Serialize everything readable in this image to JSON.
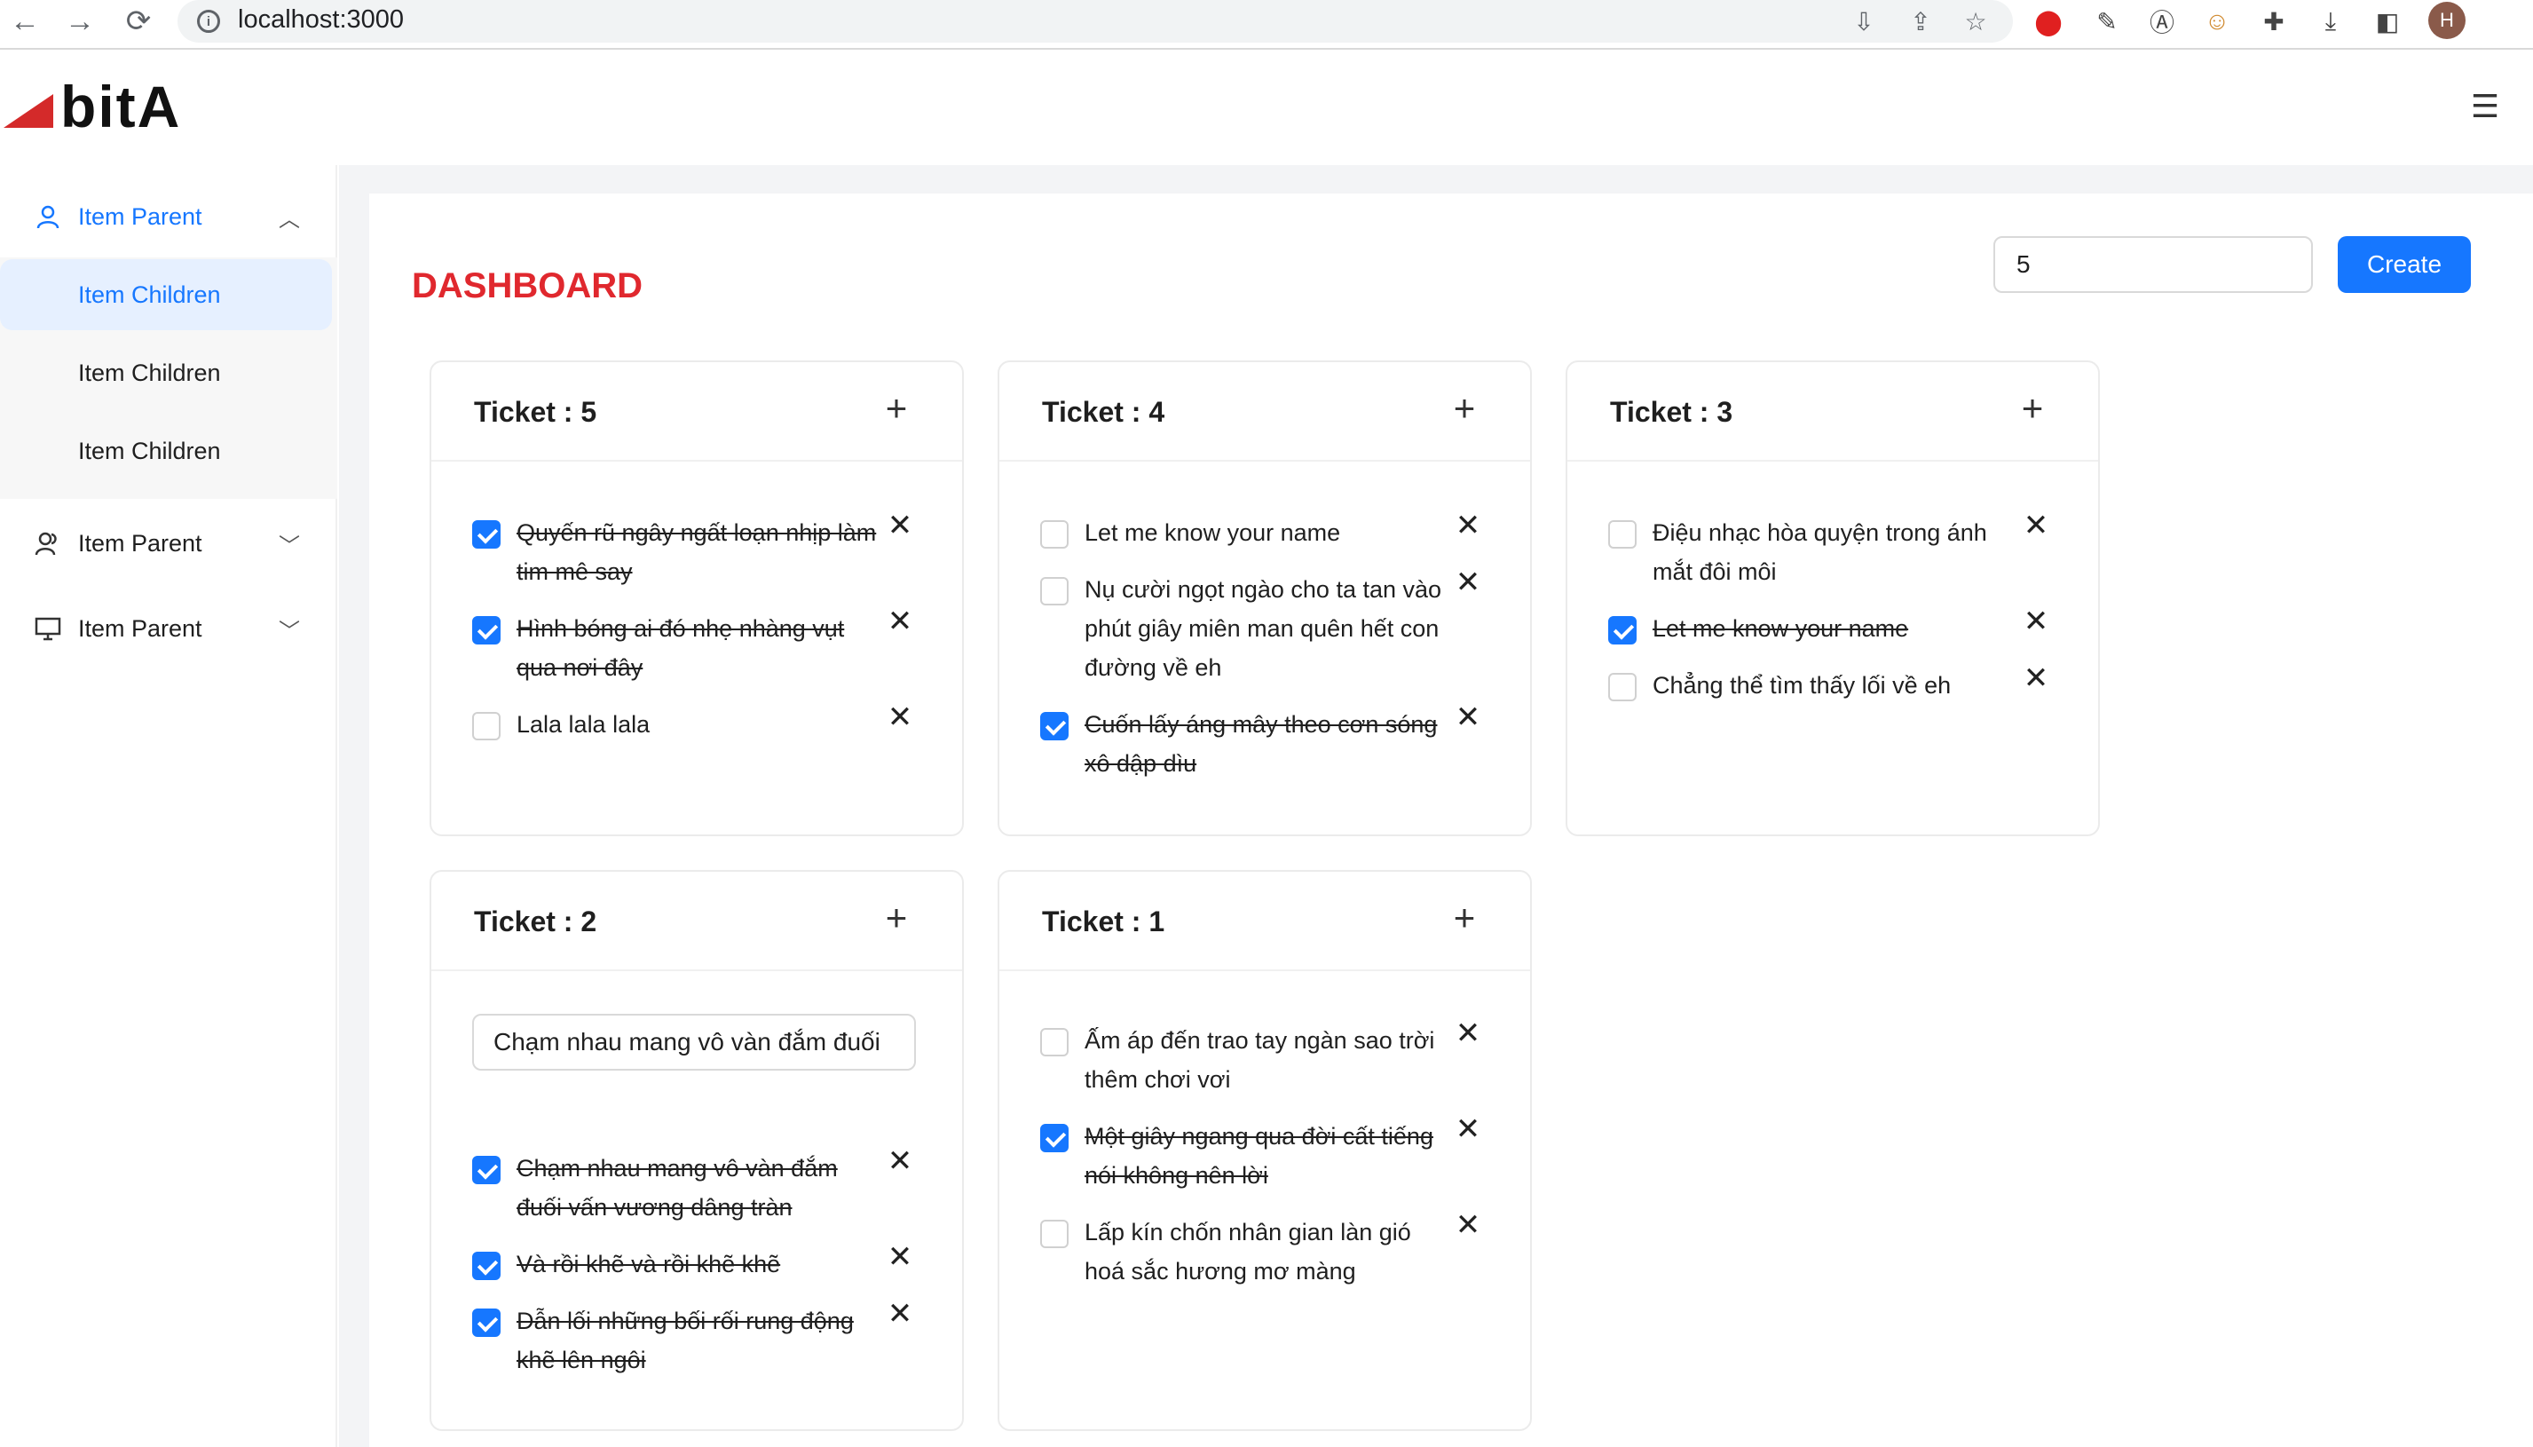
{
  "browser": {
    "url": "localhost:3000",
    "profile_initial": "H",
    "icons": [
      "back-icon",
      "forward-icon",
      "reload-icon",
      "site-info-icon",
      "install-icon",
      "share-icon",
      "bookmark-star-icon"
    ],
    "extensions": [
      "opera-extension-icon",
      "eyedropper-extension-icon",
      "font-extension-icon",
      "emoji-extension-icon",
      "puzzle-extensions-icon",
      "download-icon",
      "side-panel-icon"
    ]
  },
  "app": {
    "logo_text": "bitA",
    "brand_color": "#d42a2a"
  },
  "sidebar": {
    "parents": [
      {
        "label": "Item Parent",
        "icon": "user-icon",
        "expanded": true
      },
      {
        "label": "Item Parent",
        "icon": "users-icon",
        "expanded": false
      },
      {
        "label": "Item Parent",
        "icon": "desktop-icon",
        "expanded": false
      }
    ],
    "children": [
      {
        "label": "Item Children",
        "selected": true
      },
      {
        "label": "Item Children",
        "selected": false
      },
      {
        "label": "Item Children",
        "selected": false
      }
    ]
  },
  "dashboard": {
    "title": "DASHBOARD",
    "title_color": "#e0282e",
    "create_input_value": "5",
    "create_button": "Create",
    "accent_color": "#1677ff"
  },
  "tickets": [
    {
      "title": "Ticket : 5",
      "todos": [
        {
          "text": "Quyến rũ ngây ngất loạn nhịp làm tim mê say",
          "done": true
        },
        {
          "text": "Hình bóng ai đó nhẹ nhàng vụt qua nơi đây",
          "done": true
        },
        {
          "text": "Lala lala lala",
          "done": false
        }
      ]
    },
    {
      "title": "Ticket : 4",
      "todos": [
        {
          "text": "Let me know your name",
          "done": false
        },
        {
          "text": "Nụ cười ngọt ngào cho ta tan vào phút giây miên man quên hết con đường về eh",
          "done": false
        },
        {
          "text": "Cuốn lấy áng mây theo cơn sóng xô dập dìu",
          "done": true
        }
      ]
    },
    {
      "title": "Ticket : 3",
      "todos": [
        {
          "text": "Điệu nhạc hòa quyện trong ánh mắt đôi môi",
          "done": false
        },
        {
          "text": "Let me know your name",
          "done": true
        },
        {
          "text": "Chẳng thể tìm thấy lối về eh",
          "done": false
        }
      ]
    },
    {
      "title": "Ticket : 2",
      "input_value": "Chạm nhau mang vô vàn đắm đuối",
      "todos": [
        {
          "text": "Chạm nhau mang vô vàn đắm đuối vấn vương dâng tràn",
          "done": true
        },
        {
          "text": "Và rồi khẽ và rồi khẽ khẽ",
          "done": true
        },
        {
          "text": "Dẫn lối những bối rối rung động khẽ lên ngôi",
          "done": true
        }
      ]
    },
    {
      "title": "Ticket : 1",
      "todos": [
        {
          "text": "Ấm áp đến trao tay ngàn sao trời thêm chơi vơi",
          "done": false
        },
        {
          "text": "Một giây ngang qua đời cất tiếng nói không nên lời",
          "done": true
        },
        {
          "text": "Lấp kín chốn nhân gian làn gió hoá sắc hương mơ màng",
          "done": false
        }
      ]
    }
  ]
}
